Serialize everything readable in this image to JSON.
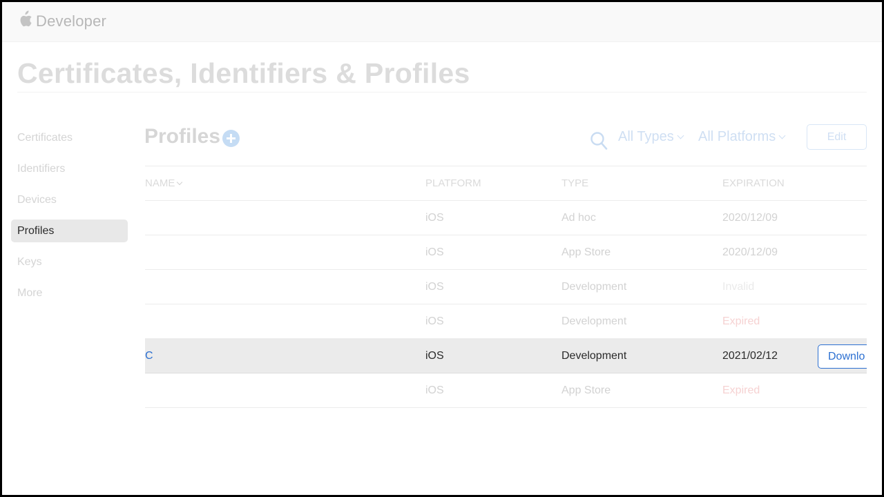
{
  "header": {
    "brand": "Developer"
  },
  "page": {
    "title": "Certificates, Identifiers & Profiles"
  },
  "sidebar": {
    "items": [
      {
        "label": "Certificates",
        "active": false
      },
      {
        "label": "Identifiers",
        "active": false
      },
      {
        "label": "Devices",
        "active": false
      },
      {
        "label": "Profiles",
        "active": true
      },
      {
        "label": "Keys",
        "active": false
      },
      {
        "label": "More",
        "active": false
      }
    ]
  },
  "section": {
    "title": "Profiles"
  },
  "toolbar": {
    "type_filter": "All Types",
    "platform_filter": "All Platforms",
    "edit_label": "Edit"
  },
  "table": {
    "columns": {
      "name": "NAME",
      "platform": "PLATFORM",
      "type": "TYPE",
      "expiration": "EXPIRATION"
    },
    "rows": [
      {
        "name": "",
        "platform": "iOS",
        "type": "Ad hoc",
        "expiration": "2020/12/09"
      },
      {
        "name": "",
        "platform": "iOS",
        "type": "App Store",
        "expiration": "2020/12/09"
      },
      {
        "name": "",
        "platform": "iOS",
        "type": "Development",
        "expiration": "Invalid"
      },
      {
        "name": "",
        "platform": "iOS",
        "type": "Development",
        "expiration": "Expired"
      },
      {
        "name": "C",
        "platform": "iOS",
        "type": "Development",
        "expiration": "2021/02/12",
        "action": "Downlo"
      },
      {
        "name": "",
        "platform": "iOS",
        "type": "App Store",
        "expiration": "Expired"
      }
    ]
  },
  "colors": {
    "accent": "#2b6fd1",
    "selected_row": "#ebebeb",
    "expired_text": "#f6d2d2",
    "faded_text": "#d2d2d2"
  },
  "icons": {
    "logo": "apple-logo-icon",
    "add": "plus-circle-icon",
    "search": "search-icon",
    "dropdown": "chevron-down-icon"
  }
}
